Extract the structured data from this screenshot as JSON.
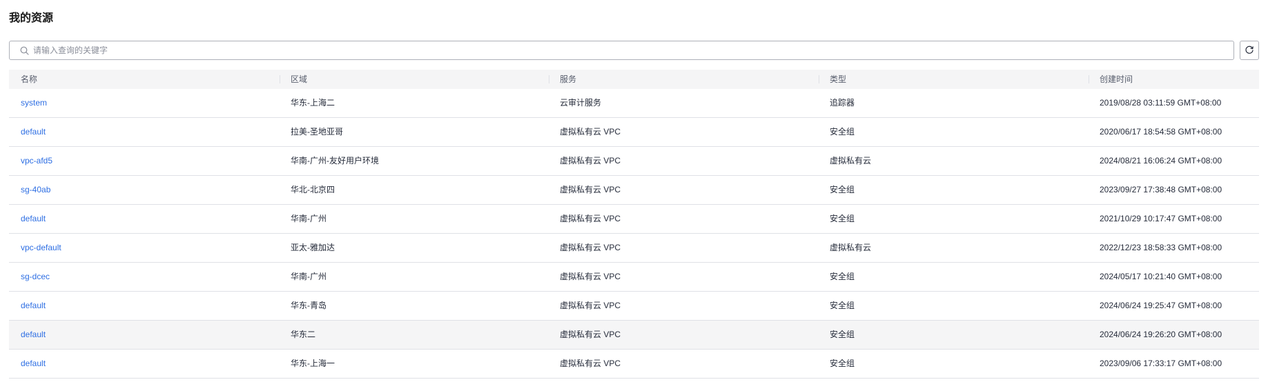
{
  "page": {
    "title": "我的资源"
  },
  "search": {
    "placeholder": "请输入查询的关键字",
    "value": ""
  },
  "icons": {
    "search": "search-icon",
    "refresh": "refresh-icon"
  },
  "colors": {
    "link": "#2d6ee3",
    "header_bg": "#f5f5f6",
    "border": "#dfe1e6"
  },
  "table": {
    "columns": [
      "名称",
      "区域",
      "服务",
      "类型",
      "创建时间"
    ],
    "rows": [
      {
        "name": "system",
        "region": "华东-上海二",
        "service": "云审计服务",
        "type": "追踪器",
        "created": "2019/08/28 03:11:59 GMT+08:00"
      },
      {
        "name": "default",
        "region": "拉美-圣地亚哥",
        "service": "虚拟私有云 VPC",
        "type": "安全组",
        "created": "2020/06/17 18:54:58 GMT+08:00"
      },
      {
        "name": "vpc-afd5",
        "region": "华南-广州-友好用户环境",
        "service": "虚拟私有云 VPC",
        "type": "虚拟私有云",
        "created": "2024/08/21 16:06:24 GMT+08:00"
      },
      {
        "name": "sg-40ab",
        "region": "华北-北京四",
        "service": "虚拟私有云 VPC",
        "type": "安全组",
        "created": "2023/09/27 17:38:48 GMT+08:00"
      },
      {
        "name": "default",
        "region": "华南-广州",
        "service": "虚拟私有云 VPC",
        "type": "安全组",
        "created": "2021/10/29 10:17:47 GMT+08:00"
      },
      {
        "name": "vpc-default",
        "region": "亚太-雅加达",
        "service": "虚拟私有云 VPC",
        "type": "虚拟私有云",
        "created": "2022/12/23 18:58:33 GMT+08:00"
      },
      {
        "name": "sg-dcec",
        "region": "华南-广州",
        "service": "虚拟私有云 VPC",
        "type": "安全组",
        "created": "2024/05/17 10:21:40 GMT+08:00"
      },
      {
        "name": "default",
        "region": "华东-青岛",
        "service": "虚拟私有云 VPC",
        "type": "安全组",
        "created": "2024/06/24 19:25:47 GMT+08:00"
      },
      {
        "name": "default",
        "region": "华东二",
        "service": "虚拟私有云 VPC",
        "type": "安全组",
        "created": "2024/06/24 19:26:20 GMT+08:00"
      },
      {
        "name": "default",
        "region": "华东-上海一",
        "service": "虚拟私有云 VPC",
        "type": "安全组",
        "created": "2023/09/06 17:33:17 GMT+08:00"
      }
    ]
  }
}
